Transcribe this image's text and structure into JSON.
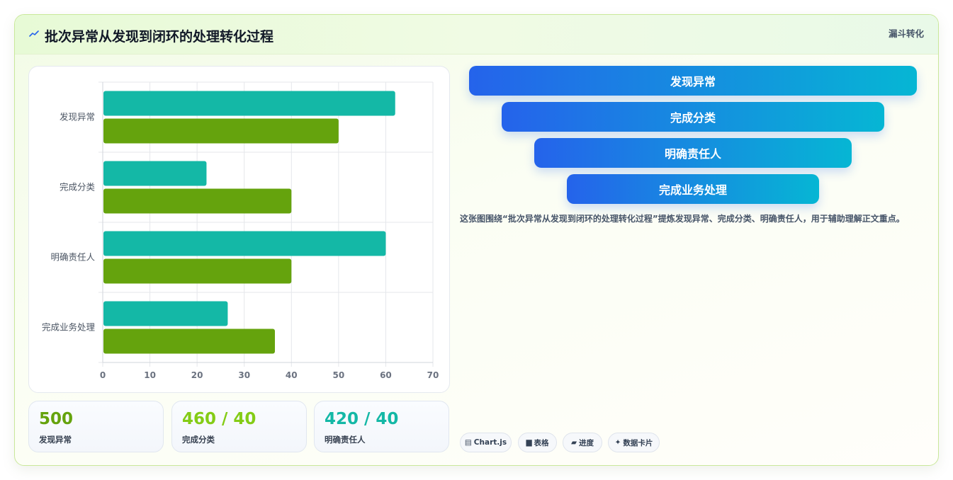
{
  "header": {
    "title": "批次异常从发现到闭环的处理转化过程",
    "tag": "漏斗转化",
    "icon": "trend-icon"
  },
  "colors": {
    "series1": "#14b8a6",
    "series2": "#65a30d",
    "funnel_start": "#2563eb",
    "funnel_end": "#06b6d4",
    "stat1": "#65a30d",
    "stat2": "#84cc16",
    "stat3": "#14b8a6"
  },
  "chart_data": {
    "type": "bar",
    "orientation": "horizontal",
    "categories": [
      "发现异常",
      "完成分类",
      "明确责任人",
      "完成业务处理"
    ],
    "series": [
      {
        "values": [
          62,
          22,
          60,
          26.5
        ]
      },
      {
        "values": [
          50,
          40,
          40,
          36.5
        ]
      }
    ],
    "xlim": [
      0,
      70
    ],
    "xticks": [
      0,
      10,
      20,
      30,
      40,
      50,
      60,
      70
    ],
    "grid": true
  },
  "stats": [
    {
      "value": "500",
      "label": "发现异常"
    },
    {
      "value": "460 / 40",
      "label": "完成分类"
    },
    {
      "value": "420 / 40",
      "label": "明确责任人"
    }
  ],
  "funnel": [
    "发现异常",
    "完成分类",
    "明确责任人",
    "完成业务处理"
  ],
  "note": "这张图围绕“批次异常从发现到闭环的处理转化过程”提炼发现异常、完成分类、明确责任人，用于辅助理解正文重点。",
  "chips": [
    {
      "icon": "▤",
      "label": "Chart.js"
    },
    {
      "icon": "▆",
      "label": "表格"
    },
    {
      "icon": "▰",
      "label": "进度"
    },
    {
      "icon": "✦",
      "label": "数据卡片"
    }
  ]
}
